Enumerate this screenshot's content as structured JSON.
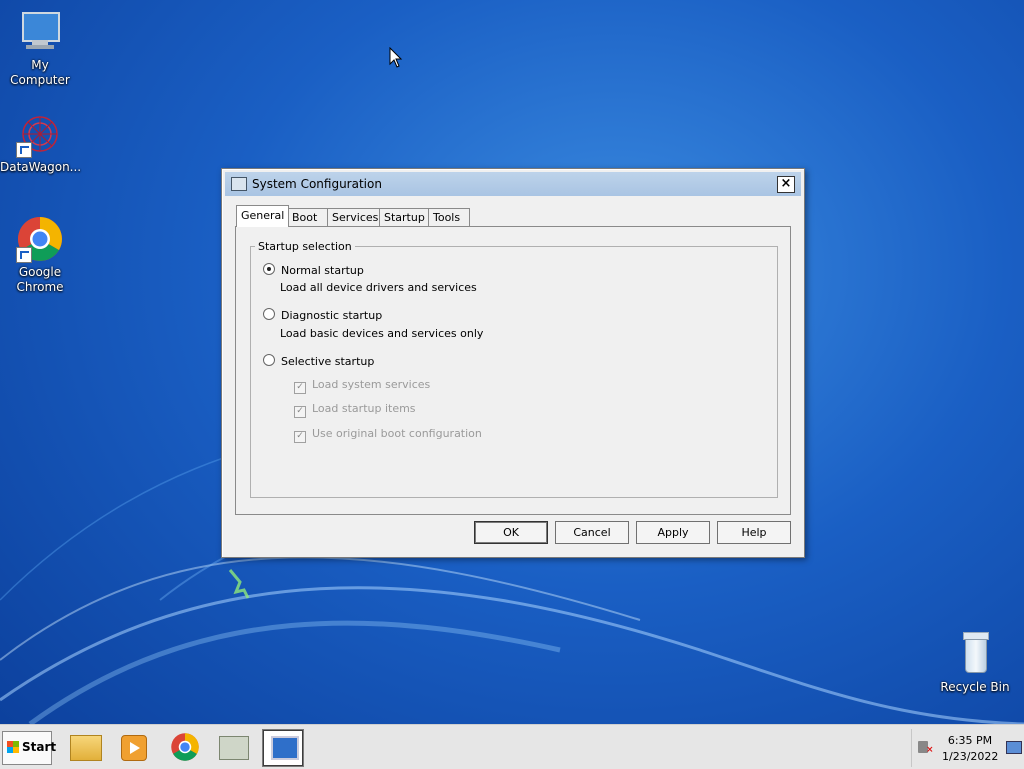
{
  "desktop": {
    "icons": [
      {
        "label": "My Computer",
        "icon": "computer-icon"
      },
      {
        "label": "DataWagon...",
        "icon": "datawagon-icon"
      },
      {
        "label": "Google Chrome",
        "icon": "chrome-icon"
      },
      {
        "label": "Recycle Bin",
        "icon": "recycle-bin-icon"
      }
    ]
  },
  "dialog": {
    "title": "System Configuration",
    "close_glyph": "×",
    "tabs": [
      "General",
      "Boot",
      "Services",
      "Startup",
      "Tools"
    ],
    "active_tab": "General",
    "group_title": "Startup selection",
    "options": [
      {
        "label": "Normal startup",
        "desc": "Load all device drivers and services",
        "selected": true
      },
      {
        "label": "Diagnostic startup",
        "desc": "Load basic devices and services only",
        "selected": false
      },
      {
        "label": "Selective startup",
        "desc": "",
        "selected": false
      }
    ],
    "checkboxes": [
      {
        "label": "Load system services",
        "checked": true,
        "disabled": true
      },
      {
        "label": "Load startup items",
        "checked": true,
        "disabled": true
      },
      {
        "label": "Use original boot configuration",
        "checked": true,
        "disabled": true
      }
    ],
    "buttons": {
      "ok": "OK",
      "cancel": "Cancel",
      "apply": "Apply",
      "help": "Help"
    }
  },
  "taskbar": {
    "start_label": "Start",
    "items": [
      "file-explorer-icon",
      "media-player-icon",
      "chrome-icon",
      "network-icon",
      "system-config-icon"
    ],
    "clock": {
      "time": "6:35 PM",
      "date": "1/23/2022"
    }
  },
  "colors": {
    "titlebar": "#b9d1ea",
    "desktop": "#1a5fc4"
  }
}
